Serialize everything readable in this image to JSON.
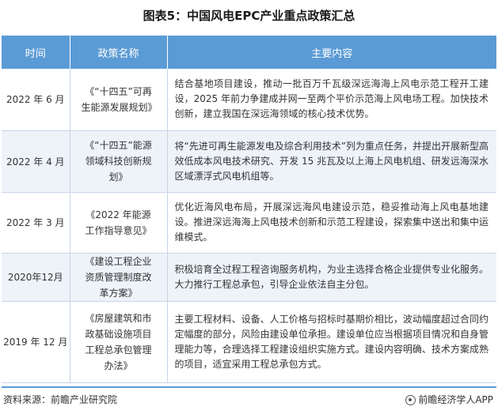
{
  "title": "图表5：中国风电EPC产业重点政策汇总",
  "table": {
    "headers": [
      "时间",
      "政策名称",
      "主要内容"
    ],
    "rows": [
      {
        "time": "2022 年 6 月",
        "name": "《“十四五”可再生能源发展规划》",
        "content": "结合基地项目建设，推动一批百万千瓦级深远海海上风电示范工程开工建设，2025 年前力争建成并网一至两个平价示范海上风电场工程。加快技术创新，建立我国在深远海领域的核心技术优势。"
      },
      {
        "time": "2022 年 4 月",
        "name": "《“十四五”能源领域科技创新规划》",
        "content": "将“先进可再生能源发电及综合利用技术”列为重点任务，并提出开展新型高效低成本风电技术研究、开发 15 兆瓦及以上海上风电机组、研发远海深水区域漂浮式风电机组等。"
      },
      {
        "time": "2022 年 3 月",
        "name": "《2022 年能源工作指导意见》",
        "content": "优化近海风电布局，开展深远海风电建设示范，稳妥推动海上风电基地建设。推进深远海海上风电技术创新和示范工程建设，探索集中送出和集中运维模式。"
      },
      {
        "time": "2020年12月",
        "name": "《建设工程企业资质管理制度改革方案》",
        "content": "积极培育全过程工程咨询服务机构，为业主选择合格企业提供专业化服务。大力推行工程总承包，引导企业依法自主分包。"
      },
      {
        "time": "2019 年 12 月",
        "name": "《房屋建筑和市政基础设施项目工程总承包管理办法》",
        "content": "主要工程材料、设备、人工价格与招标时基期价相比，波动幅度超过合同约定幅度的部分，风险由建设单位承担。建设单位应当根据项目情况和自身管理能力等，合理选择工程建设组织实施方式。建设内容明确、技术方案成熟的项目，适宜采用工程总承包方式。"
      }
    ]
  },
  "footer": {
    "source": "资料来源：前瞻产业研究院",
    "brand": "前瞻经济学人APP"
  }
}
